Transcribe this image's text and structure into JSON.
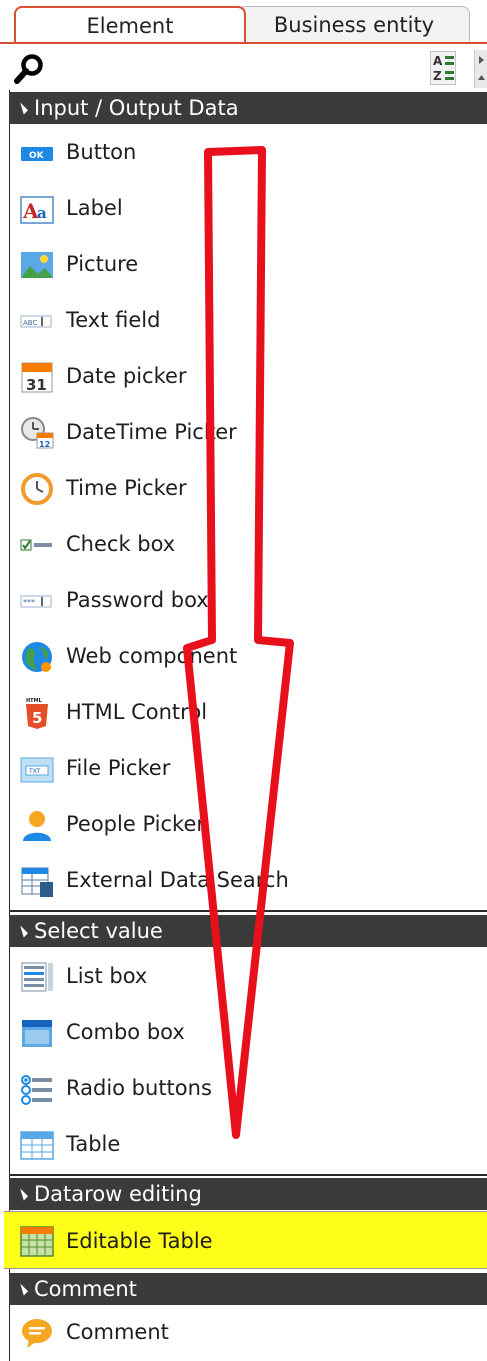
{
  "tabs": [
    {
      "label": "Element",
      "active": true
    },
    {
      "label": "Business entity",
      "active": false
    }
  ],
  "toolbar": {
    "search_icon": "search-icon",
    "sort_icon": "sort-az-icon"
  },
  "colors": {
    "accent_tab": "#d9502f",
    "section_header_bg": "#3b3b3b",
    "highlight": "#ffff1a",
    "annotation_arrow": "#e8101c"
  },
  "sections": {
    "input_output": {
      "title": "Input / Output Data",
      "items": [
        {
          "label": "Button",
          "icon": "button-ok-icon"
        },
        {
          "label": "Label",
          "icon": "label-aa-icon"
        },
        {
          "label": "Picture",
          "icon": "picture-icon"
        },
        {
          "label": "Text field",
          "icon": "text-field-icon"
        },
        {
          "label": "Date picker",
          "icon": "calendar-31-icon"
        },
        {
          "label": "DateTime Picker",
          "icon": "datetime-icon"
        },
        {
          "label": "Time Picker",
          "icon": "clock-icon"
        },
        {
          "label": "Check box",
          "icon": "checkbox-icon"
        },
        {
          "label": "Password box",
          "icon": "password-icon"
        },
        {
          "label": "Web component",
          "icon": "globe-icon"
        },
        {
          "label": "HTML Control",
          "icon": "html5-icon"
        },
        {
          "label": "File Picker",
          "icon": "file-picker-icon"
        },
        {
          "label": "People Picker",
          "icon": "person-icon"
        },
        {
          "label": "External Data Search",
          "icon": "external-data-icon"
        }
      ]
    },
    "select_value": {
      "title": "Select value",
      "items": [
        {
          "label": "List box",
          "icon": "list-box-icon"
        },
        {
          "label": "Combo box",
          "icon": "combo-box-icon"
        },
        {
          "label": "Radio buttons",
          "icon": "radio-buttons-icon"
        },
        {
          "label": "Table",
          "icon": "table-icon"
        }
      ]
    },
    "datarow_editing": {
      "title": "Datarow editing",
      "items": [
        {
          "label": "Editable Table",
          "icon": "editable-table-icon",
          "highlighted": true
        }
      ]
    },
    "comment": {
      "title": "Comment",
      "items": [
        {
          "label": "Comment",
          "icon": "comment-bubble-icon"
        }
      ]
    }
  }
}
